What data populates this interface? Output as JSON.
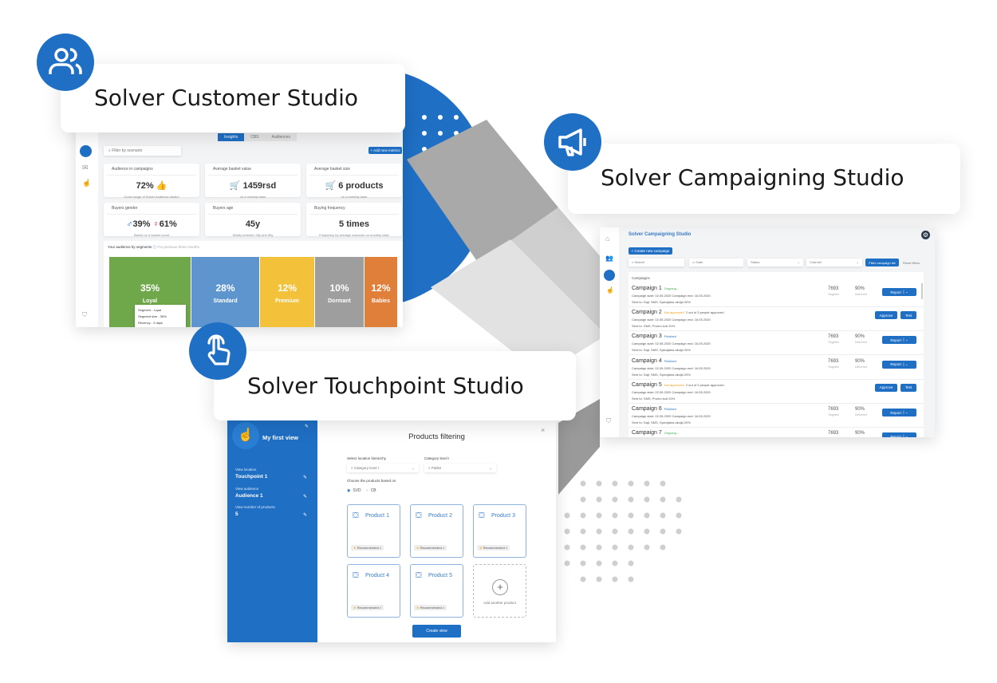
{
  "accent": "#1f6fc5",
  "customer": {
    "title": "Solver Customer Studio",
    "icon": "users-icon",
    "tabs": [
      "Insights",
      "CBS",
      "Audiences"
    ],
    "filter_placeholder": "Filter by scenario",
    "add_button": "+ Add new metrics",
    "tiles": [
      {
        "label": "Audience in campaigns",
        "value": "72%",
        "sub": "Good usage of Solver Audience studio!"
      },
      {
        "label": "Average basket value",
        "value": "1459rsd",
        "sub": "on a monthly base"
      },
      {
        "label": "Average basket size",
        "value": "6 products",
        "sub": "on a monthly base"
      },
      {
        "label": "Buyers gender",
        "value_male": "39%",
        "value_female": "61%",
        "sub": "Based on a basket count"
      },
      {
        "label": "Buyers age",
        "value": "45y",
        "sub": "Mostly between 35y and 55y"
      },
      {
        "label": "Buying frequency",
        "value": "5 times",
        "sub": "Frequency by average customer on monthly base"
      }
    ],
    "segments_title": "Your audience by segments",
    "segments_note": "For previous three months",
    "segments": [
      {
        "pct": "35%",
        "name": "Loyal",
        "color": "#6fa84a"
      },
      {
        "pct": "28%",
        "name": "Standard",
        "color": "#5f95cf"
      },
      {
        "pct": "12%",
        "name": "Premium",
        "color": "#f3c13a"
      },
      {
        "pct": "10%",
        "name": "Dormant",
        "color": "#9e9e9e"
      },
      {
        "pct": "12%",
        "name": "Babies",
        "color": "#e07f3a"
      }
    ],
    "tooltip": [
      "Segment - Loyal",
      "Segment size - 35%",
      "Recency - 3 days"
    ]
  },
  "campaign": {
    "title": "Solver Campaigning Studio",
    "icon": "megaphone-icon",
    "app_title": "Solver Campaigning Studio",
    "create_button": "+ Create new campaign",
    "search_placeholder": "Search",
    "date_placeholder": "Date",
    "status_placeholder": "Status",
    "channel_placeholder": "Channel",
    "filter_button": "Filter campaign list",
    "reset_button": "Reset filters",
    "list_title": "Campaigns",
    "rows": [
      {
        "name": "Campaign 1",
        "status": "Ongoing...",
        "status_color": "#4caf50",
        "note": "",
        "dates": "Campaign start: 02.05.2020    Campaign end: 16.05.2020",
        "sent": "Sent to: Sajt, SMS, Specijalna akcija 20%",
        "targeted": "7693",
        "delivered": "90%",
        "actions": [
          "Report"
        ]
      },
      {
        "name": "Campaign 2",
        "status": "Not approved!",
        "status_color": "#f39c12",
        "note": "2 out of 3 people approved.",
        "dates": "Campaign start: 02.05.2020    Campaign end: 16.05.2020",
        "sent": "Sent to: SMS, Promo kod 20%",
        "targeted": "",
        "delivered": "",
        "actions": [
          "Approve",
          "Test"
        ]
      },
      {
        "name": "Campaign 3",
        "status": "Finished",
        "status_color": "#1f6fc5",
        "note": "",
        "dates": "Campaign start: 02.05.2020    Campaign end: 16.05.2020",
        "sent": "Sent to: Sajt, SMS, Specijalna akcija 20%",
        "targeted": "7693",
        "delivered": "90%",
        "actions": [
          "Report"
        ]
      },
      {
        "name": "Campaign 4",
        "status": "Finished",
        "status_color": "#1f6fc5",
        "note": "",
        "dates": "Campaign start: 02.05.2020    Campaign end: 16.05.2020",
        "sent": "Sent to: Sajt, SMS, Specijalna akcija 20%",
        "targeted": "7693",
        "delivered": "90%",
        "actions": [
          "Report"
        ]
      },
      {
        "name": "Campaign 5",
        "status": "Not approved!",
        "status_color": "#f39c12",
        "note": "2 out of 3 people approved.",
        "dates": "Campaign start: 02.05.2020    Campaign end: 16.05.2020",
        "sent": "Sent to: SMS, Promo kod 20%",
        "targeted": "",
        "delivered": "",
        "actions": [
          "Approve",
          "Test"
        ]
      },
      {
        "name": "Campaign 6",
        "status": "Finished",
        "status_color": "#1f6fc5",
        "note": "",
        "dates": "Campaign start: 02.05.2020    Campaign end: 16.05.2020",
        "sent": "Sent to: Sajt, SMS, Specijalna akcija 20%",
        "targeted": "7693",
        "delivered": "90%",
        "actions": [
          "Report"
        ]
      },
      {
        "name": "Campaign 7",
        "status": "Ongoing...",
        "status_color": "#4caf50",
        "note": "",
        "dates": "",
        "sent": "",
        "targeted": "7693",
        "delivered": "90%",
        "actions": [
          "Report"
        ]
      }
    ],
    "targeted_label": "Targeted",
    "delivered_label": "Delivered"
  },
  "touchpoint": {
    "title": "Solver Touchpoint Studio",
    "icon": "hand-pointer-icon",
    "view_name": "My first view",
    "fields": [
      {
        "label": "View location",
        "value": "Touchpoint 1"
      },
      {
        "label": "View audience",
        "value": "Audience 1"
      },
      {
        "label": "View number of products",
        "value": "5"
      }
    ],
    "dialog_title": "Products filtering",
    "hierarchy_label": "Select location hierarchy",
    "hierarchy_value": "Category level I",
    "category_label": "Category level I",
    "category_value": "Patike",
    "choose_label": "Choose the products based on",
    "options": [
      "SVD",
      "CB"
    ],
    "selected_option": "SVD",
    "products": [
      "Product 1",
      "Product 2",
      "Product 3",
      "Product 4",
      "Product 5"
    ],
    "tag": "Recommended",
    "add_product": "Add another product",
    "create_button": "Create view"
  }
}
